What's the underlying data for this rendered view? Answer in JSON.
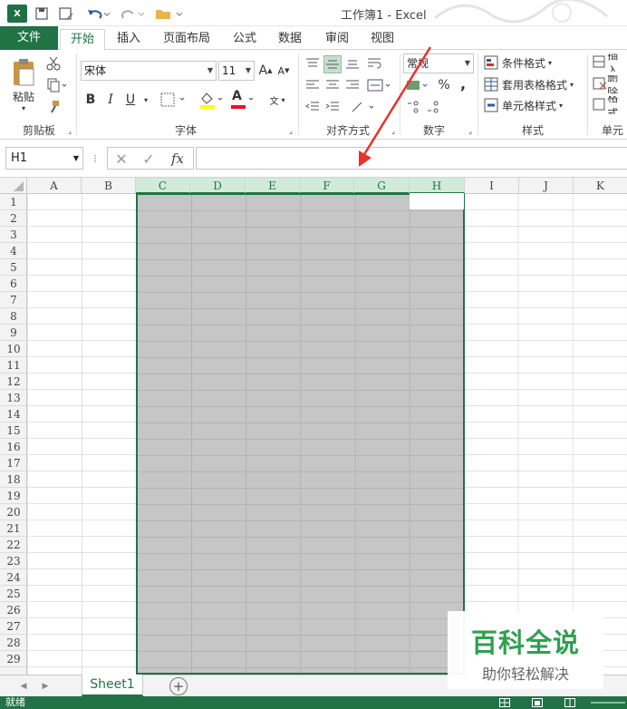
{
  "app_icon": "X",
  "window_title": "工作簿1 - Excel",
  "tabs": {
    "file": "文件",
    "home": "开始",
    "insert": "插入",
    "layout": "页面布局",
    "formulas": "公式",
    "data": "数据",
    "review": "审阅",
    "view": "视图"
  },
  "ribbon": {
    "paste": "粘贴",
    "font_name": "宋体",
    "font_size": "11",
    "bold": "B",
    "italic": "I",
    "underline": "U",
    "grow_font": "A",
    "shrink_font": "A",
    "font_color_glyph": "A",
    "phonetic": "文",
    "number_format": "常规",
    "percent": "%",
    "comma": ",",
    "conditional_format": "条件格式",
    "format_as_table": "套用表格格式",
    "cell_styles": "单元格样式",
    "insert_cells": "插入",
    "delete_cells": "删除",
    "format_cells": "格式",
    "groups": {
      "clipboard": "剪贴板",
      "font": "字体",
      "alignment": "对齐方式",
      "number": "数字",
      "styles": "样式",
      "cells": "单元"
    }
  },
  "formula_bar": {
    "name_box": "H1",
    "fx": "fx",
    "cancel": "✕",
    "enter": "✓",
    "formula": ""
  },
  "columns": [
    "A",
    "B",
    "C",
    "D",
    "E",
    "F",
    "G",
    "H",
    "I",
    "J",
    "K"
  ],
  "rows": [
    "1",
    "2",
    "3",
    "4",
    "5",
    "6",
    "7",
    "8",
    "9",
    "10",
    "11",
    "12",
    "13",
    "14",
    "15",
    "16",
    "17",
    "18",
    "19",
    "20",
    "21",
    "22",
    "23",
    "24",
    "25",
    "26",
    "27",
    "28",
    "29"
  ],
  "sheet_tab": "Sheet1",
  "add_sheet": "+",
  "status": "就绪",
  "watermark": {
    "title": "百科全说",
    "subtitle": "助你轻松解决"
  },
  "colors": {
    "excel_green": "#217346",
    "selection_gray": "#c6c6c6",
    "arrow_red": "#e8322c",
    "watermark_green": "#2ea04f"
  }
}
